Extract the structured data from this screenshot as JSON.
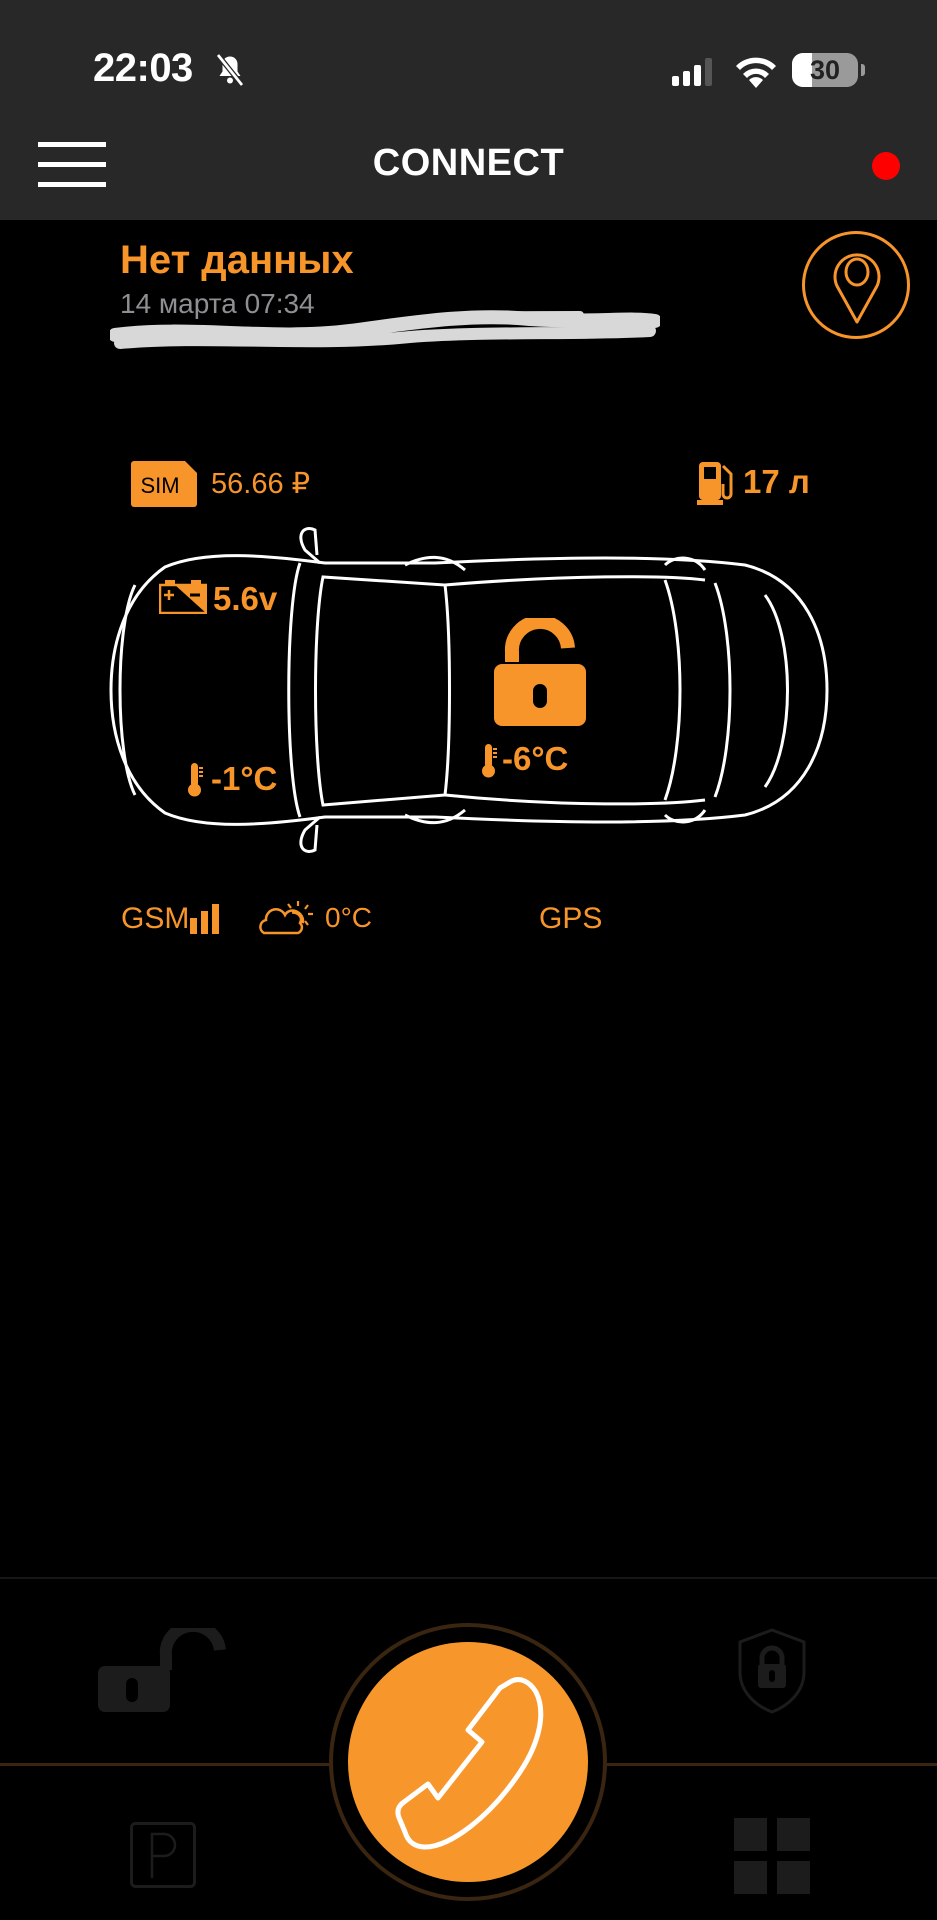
{
  "status_bar": {
    "time": "22:03",
    "battery_level": "30",
    "battery_fraction": 0.3,
    "icons": [
      "bell-slash-icon",
      "cellular-signal-icon",
      "wifi-icon",
      "battery-icon"
    ]
  },
  "header": {
    "title": "CONNECT",
    "menu_icon": "hamburger-menu-icon",
    "status_dot_color": "#ff0000"
  },
  "vehicle": {
    "state_label": "Нет данных",
    "last_update": "14 марта 07:34",
    "address_redacted": true,
    "location_icon": "map-pin-icon"
  },
  "metrics": {
    "sim_badge": "SIM",
    "sim_balance": "56.66 ₽",
    "fuel": "17 л",
    "battery_voltage": "5.6v",
    "engine_temp": "-1°C",
    "cabin_temp": "-6°C",
    "lock_state": "unlocked",
    "gsm_label": "GSM",
    "weather_temp": "0°C",
    "gps_label": "GPS"
  },
  "actions": [
    {
      "name": "unlock",
      "icon": "unlock-icon"
    },
    {
      "name": "security",
      "icon": "shield-lock-icon"
    },
    {
      "name": "parking",
      "icon": "parking-icon"
    },
    {
      "name": "menu-grid",
      "icon": "grid-icon"
    },
    {
      "name": "call",
      "icon": "phone-icon"
    }
  ],
  "colors": {
    "accent": "#f7952a",
    "topbar": "#282828",
    "background": "#000000",
    "muted_text": "#8e8e93",
    "inactive_icon": "#1c1c1c"
  }
}
